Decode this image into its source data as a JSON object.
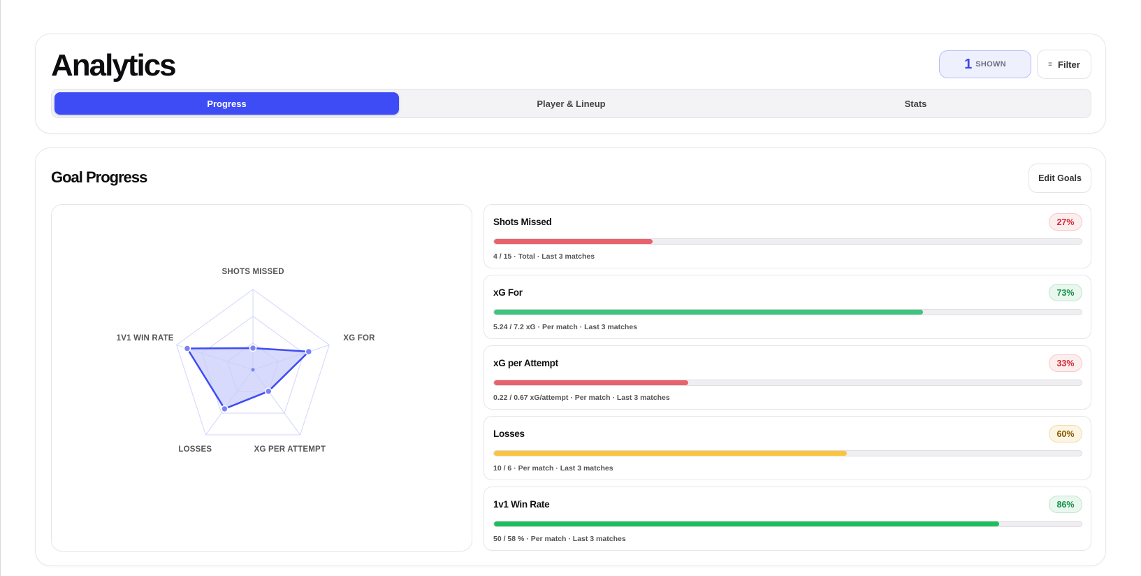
{
  "header": {
    "title": "Analytics",
    "shown_count": "1",
    "shown_label": "SHOWN",
    "filter_label": "Filter",
    "filter_icon": "≡",
    "tabs": [
      {
        "label": "Progress",
        "active": true
      },
      {
        "label": "Player & Lineup",
        "active": false
      },
      {
        "label": "Stats",
        "active": false
      }
    ]
  },
  "goals_section": {
    "title": "Goal Progress",
    "edit_label": "Edit Goals"
  },
  "radar": {
    "axes": [
      "SHOTS MISSED",
      "XG FOR",
      "XG PER ATTEMPT",
      "LOSSES",
      "1V1 WIN RATE"
    ],
    "values": [
      0.27,
      0.73,
      0.33,
      0.6,
      0.86
    ],
    "colors": {
      "fill": "#c9cdfa",
      "stroke": "#3e4cf6",
      "grid": "#d3d6fb",
      "point": "#7a83f3"
    }
  },
  "goals": [
    {
      "name": "Shots Missed",
      "pct_label": "27%",
      "progress": 0.27,
      "status": "red",
      "color": "#e8626b",
      "meta": "4 / 15 · Total · Last 3 matches"
    },
    {
      "name": "xG For",
      "pct_label": "73%",
      "progress": 0.73,
      "status": "green",
      "color": "#3ec47e",
      "meta": "5.24 / 7.2 xG · Per match · Last 3 matches"
    },
    {
      "name": "xG per Attempt",
      "pct_label": "33%",
      "progress": 0.33,
      "status": "red",
      "color": "#e8626b",
      "meta": "0.22 / 0.67 xG/attempt · Per match · Last 3 matches"
    },
    {
      "name": "Losses",
      "pct_label": "60%",
      "progress": 0.6,
      "status": "amber",
      "color": "#fbc43c",
      "meta": "10 / 6 · Per match · Last 3 matches"
    },
    {
      "name": "1v1 Win Rate",
      "pct_label": "86%",
      "progress": 0.86,
      "status": "green",
      "color": "#1ebd5e",
      "meta": "50 / 58 % · Per match · Last 3 matches"
    }
  ]
}
